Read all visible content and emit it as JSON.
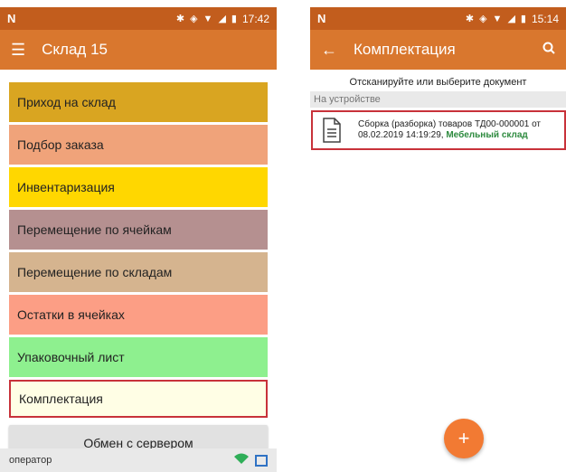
{
  "left": {
    "status_time": "17:42",
    "title": "Склад 15",
    "menu": [
      {
        "label": "Приход на склад",
        "color": "#d9a521"
      },
      {
        "label": "Подбор заказа",
        "color": "#f0a37a"
      },
      {
        "label": "Инвентаризация",
        "color": "#ffd700"
      },
      {
        "label": "Перемещение по ячейкам",
        "color": "#b59090"
      },
      {
        "label": "Перемещение по складам",
        "color": "#d5b48f"
      },
      {
        "label": "Остатки в ячейках",
        "color": "#fc9e85"
      },
      {
        "label": "Упаковочный лист",
        "color": "#8ef08f"
      },
      {
        "label": "Комплектация",
        "color": "#fffee5"
      }
    ],
    "exchange_button": "Обмен с сервером",
    "operator_label": "оператор"
  },
  "right": {
    "status_time": "15:14",
    "title": "Комплектация",
    "prompt": "Отсканируйте или выберите документ",
    "section": "На устройстве",
    "doc_line1": "Сборка (разборка) товаров ТД00-000001 от",
    "doc_date": "08.02.2019 14:19:29, ",
    "doc_warehouse": "Мебельный склад",
    "fab_label": "+"
  },
  "icons": {
    "menu": "hamburger-icon",
    "back": "back-arrow-icon",
    "search": "search-icon",
    "doc": "document-icon",
    "wifi": "wifi-icon",
    "device": "device-icon"
  },
  "colors": {
    "statusbar": "#c25d1d",
    "appbar": "#d9772e",
    "selection": "#c8323a",
    "fab": "#f27a33",
    "warehouse_text": "#2d8a3e"
  }
}
